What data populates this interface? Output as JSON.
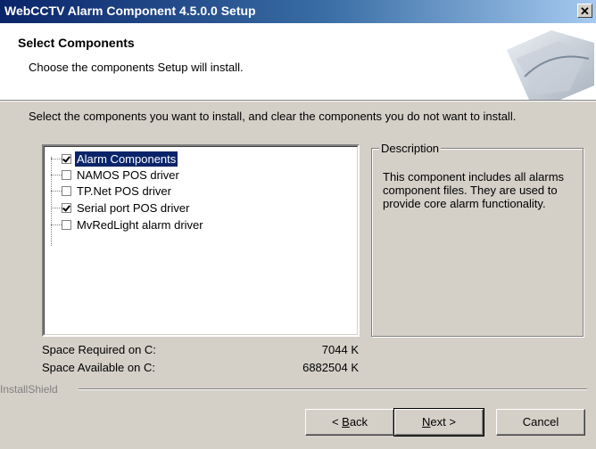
{
  "window": {
    "title": "WebCCTV Alarm Component 4.5.0.0 Setup",
    "close_glyph": "✕"
  },
  "header": {
    "title": "Select Components",
    "subtitle": "Choose the components Setup will install."
  },
  "instruction": "Select the components you want to install, and clear the components you do not want to install.",
  "components": [
    {
      "label": "Alarm Components",
      "checked": true,
      "selected": true
    },
    {
      "label": "NAMOS POS driver",
      "checked": false,
      "selected": false
    },
    {
      "label": "TP.Net POS driver",
      "checked": false,
      "selected": false
    },
    {
      "label": "Serial port POS driver",
      "checked": true,
      "selected": false
    },
    {
      "label": "MvRedLight alarm driver",
      "checked": false,
      "selected": false
    }
  ],
  "description": {
    "legend": "Description",
    "text": "This component includes all alarms component files. They are used to provide core alarm functionality."
  },
  "space": {
    "required_label": "Space Required on  C:",
    "required_value": "7044 K",
    "available_label": "Space Available on  C:",
    "available_value": "6882504 K"
  },
  "brand": "InstallShield",
  "buttons": {
    "back": {
      "pre": "< ",
      "key": "B",
      "post": "ack"
    },
    "next": {
      "pre": "",
      "key": "N",
      "post": "ext >"
    },
    "cancel": "Cancel"
  }
}
